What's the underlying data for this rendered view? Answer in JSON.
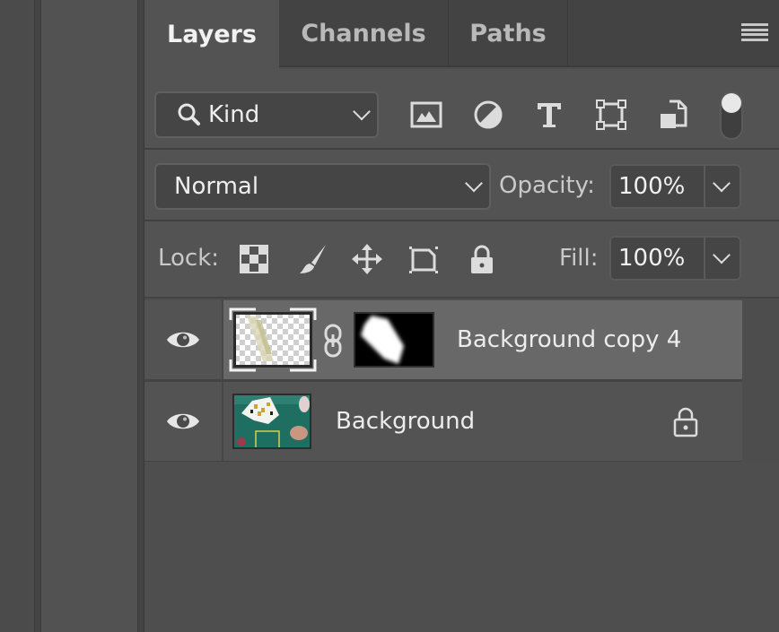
{
  "panel": {
    "tabs": [
      {
        "label": "Layers",
        "active": true
      },
      {
        "label": "Channels",
        "active": false
      },
      {
        "label": "Paths",
        "active": false
      }
    ],
    "menu_icon": "hamburger-menu-icon"
  },
  "filter": {
    "kind_label": "Kind",
    "filter_icons": [
      "pixel-layer-filter-icon",
      "adjustment-layer-filter-icon",
      "type-layer-filter-icon",
      "shape-layer-filter-icon",
      "smart-object-filter-icon"
    ],
    "filter_toggle_on": true
  },
  "blend": {
    "mode": "Normal",
    "opacity_label": "Opacity:",
    "opacity_value": "100%"
  },
  "lock": {
    "label": "Lock:",
    "icons": [
      "lock-transparent-pixels-icon",
      "lock-image-pixels-icon",
      "lock-position-icon",
      "lock-artboard-icon",
      "lock-all-icon"
    ],
    "fill_label": "Fill:",
    "fill_value": "100%"
  },
  "layers": [
    {
      "name": "Background copy 4",
      "visible": true,
      "selected": true,
      "has_mask": true,
      "linked": true,
      "locked": false
    },
    {
      "name": "Background",
      "visible": true,
      "selected": false,
      "has_mask": false,
      "linked": false,
      "locked": true
    }
  ],
  "colors": {
    "panel_bg": "#535353",
    "selected_row": "#686868",
    "tab_bar": "#434343",
    "text": "#ececec"
  }
}
